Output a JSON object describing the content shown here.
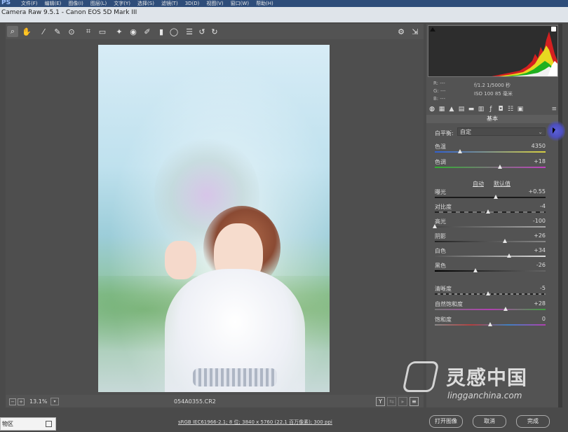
{
  "ps_logo": "PS",
  "ps_menu": [
    "文件(F)",
    "编辑(E)",
    "图像(I)",
    "图层(L)",
    "文字(Y)",
    "选择(S)",
    "滤镜(T)",
    "3D(D)",
    "视图(V)",
    "窗口(W)",
    "帮助(H)"
  ],
  "window_title": "Camera Raw 9.5.1 -  Canon EOS 5D Mark III",
  "tool_icons": [
    "zoom-icon",
    "hand-icon",
    "white-balance-icon",
    "color-sampler-icon",
    "target-adjust-icon",
    "crop-icon",
    "straighten-icon",
    "spot-removal-icon",
    "red-eye-icon",
    "adjustment-brush-icon",
    "graduated-filter-icon",
    "radial-filter-icon",
    "list-icon",
    "rotate-left-icon",
    "rotate-right-icon"
  ],
  "status": {
    "zoom": "13.1%",
    "filename": "054A0355.CR2"
  },
  "histogram": {
    "r": "R:  ---",
    "g": "G:  ---",
    "b": "B:  ---"
  },
  "camera_info": {
    "line1": "f/1.2   1/5000 秒",
    "line2": "ISO 100   85 毫米"
  },
  "panel": {
    "title": "基本",
    "wb_label": "白平衡:",
    "wb_value": "自定",
    "auto_label": "自动",
    "default_label": "默认值"
  },
  "sliders": {
    "temperature": {
      "label": "色温",
      "value": "4350",
      "position": 0.23
    },
    "tint": {
      "label": "色调",
      "value": "+18",
      "position": 0.59
    },
    "exposure": {
      "label": "曝光",
      "value": "+0.55",
      "position": 0.55
    },
    "contrast": {
      "label": "对比度",
      "value": "-4",
      "position": 0.48
    },
    "highlights": {
      "label": "高光",
      "value": "-100",
      "position": 0.0
    },
    "shadows": {
      "label": "阴影",
      "value": "+26",
      "position": 0.63
    },
    "whites": {
      "label": "白色",
      "value": "+34",
      "position": 0.67
    },
    "blacks": {
      "label": "黑色",
      "value": "-26",
      "position": 0.37
    },
    "clarity": {
      "label": "清晰度",
      "value": "-5",
      "position": 0.48
    },
    "vibrance": {
      "label": "自然饱和度",
      "value": "+28",
      "position": 0.64
    },
    "saturation": {
      "label": "饱和度",
      "value": "0",
      "position": 0.5
    }
  },
  "workflow_text": "sRGB IEC61966-2.1; 8 位; 3840 x 5760 (22.1 百万像素); 300 ppi",
  "buttons": {
    "open": "打开图像",
    "cancel": "取消",
    "done": "完成"
  },
  "taskbar_item": "物区",
  "watermark": {
    "title": "灵感中国",
    "url": "lingganchina.com"
  },
  "colors": {
    "menubar": "#2e4d7a",
    "panel_bg": "#535353",
    "preview_bg": "#4e4e4e"
  }
}
